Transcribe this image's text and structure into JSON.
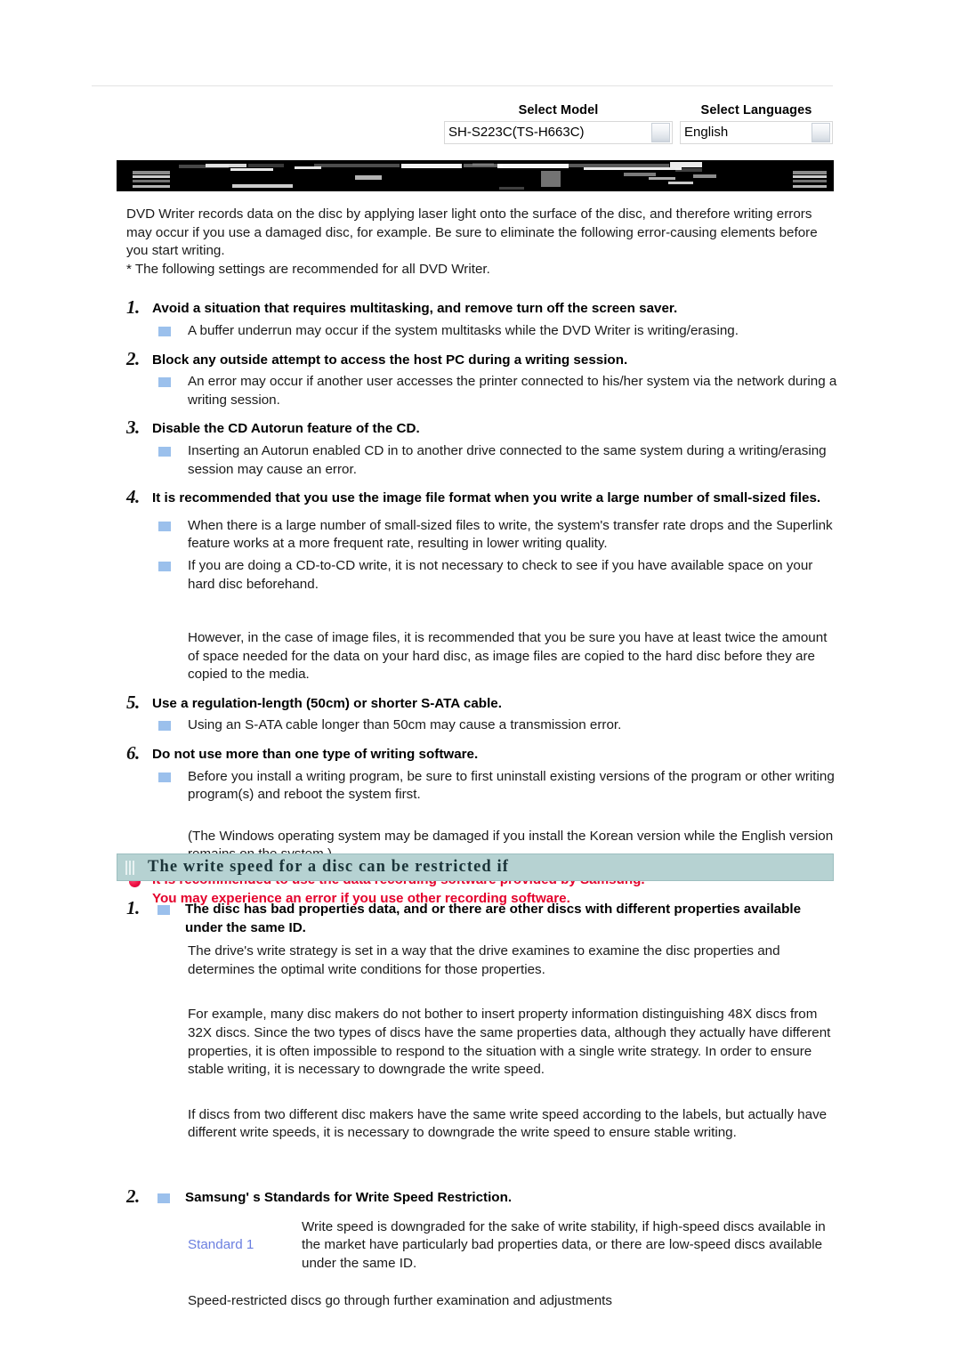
{
  "header": {
    "model_selector": {
      "title": "Select Model",
      "value": "SH-S223C(TS-H663C)"
    },
    "language_selector": {
      "title": "Select Languages",
      "value": "English"
    }
  },
  "intro": {
    "paragraph": "DVD Writer records data on the disc by applying laser light onto the surface of the disc, and therefore writing errors may occur if you use a damaged disc, for example. Be sure to eliminate the following error-causing elements before you start writing.",
    "note": "* The following settings are recommended for all DVD Writer."
  },
  "items": {
    "n1": "1.",
    "t1": "Avoid a situation that requires multitasking, and remove turn off the screen saver.",
    "b1": "A buffer underrun may occur if the system multitasks while the DVD Writer is writing/erasing.",
    "n2": "2.",
    "t2": "Block any outside attempt to access the host PC during a writing session.",
    "b2": "An error may occur if another user accesses the printer connected to his/her system via the network during a writing session.",
    "n3": "3.",
    "t3": "Disable the CD Autorun feature of the CD.",
    "b3": "Inserting an Autorun enabled CD in to another drive connected to the same system during a writing/erasing session may cause an error.",
    "n4": "4.",
    "t4": "It is recommended that you use the image file format when you write a large number of small-sized files.",
    "b4a": "When there is a large number of small-sized files to write, the system's transfer rate drops and the Superlink feature works at a more frequent rate, resulting in lower writing quality.",
    "b4b": "If you are doing a CD-to-CD write, it is not necessary to check to see if you have available space on your hard disc beforehand.",
    "p4": "However, in the case of image files, it is recommended that you be sure you have at least twice the amount of space needed for the data on your hard disc, as image files are copied to the hard disc before they are copied to the media.",
    "n5": "5.",
    "t5": "Use a regulation-length (50cm) or shorter S-ATA cable.",
    "b5": "Using an S-ATA cable longer than 50cm may cause a transmission error.",
    "n6": "6.",
    "t6": "Do not use more than one type of writing software.",
    "b6": "Before you install a writing program, be sure to first uninstall existing versions of the program or other writing program(s) and reboot the system first.",
    "p6": "(The Windows operating system may be damaged if you install the Korean version while the English version remains on the system.)"
  },
  "notice": {
    "line1": "It is recommended to use the data recording software provided by Samsung.",
    "line2": "You may experience an error if you use other recording software."
  },
  "section": {
    "title": "The write speed for a disc can be restricted if"
  },
  "restriction": {
    "n1": "1.",
    "t1": "The disc has bad properties data, and or there are other discs with different properties available under the same ID.",
    "p1a": "The drive's write strategy is set in a way that the drive examines to examine the disc properties and determines the optimal write conditions for those properties.",
    "p1b": "For example, many disc makers do not bother to insert property information distinguishing 48X discs from 32X discs. Since the two types of discs have the same properties data, although they actually have different properties, it is often impossible to respond to the situation with a single write strategy. In order to ensure stable writing, it is necessary to downgrade the write speed.",
    "p1c": "If discs from two different disc makers have the same write speed according to the labels, but actually have different write speeds, it is necessary to downgrade the write speed to ensure stable writing.",
    "n2": "2.",
    "t2": "Samsung' s Standards for Write Speed Restriction.",
    "standard_label": "Standard 1",
    "standard_text": "Write speed is downgraded for the sake of write stability, if high-speed discs available in the market have particularly bad properties data, or there are low-speed discs available under the same ID.",
    "closing": "Speed-restricted discs go through further examination and adjustments"
  },
  "colors": {
    "bullet_square": "#9bc0ec",
    "notice_red": "#e4002b",
    "section_bar": "#b6d2d2",
    "standard_blue": "#6b7fe0"
  }
}
